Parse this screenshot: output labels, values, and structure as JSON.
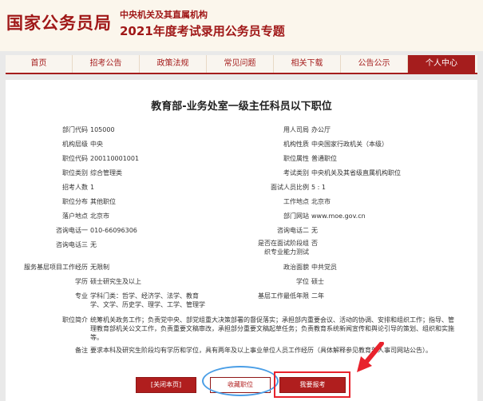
{
  "header": {
    "logo": "国家公务员局",
    "sub1": "中央机关及其直属机构",
    "sub2": "2021年度考试录用公务员专题"
  },
  "nav": {
    "items": [
      "首页",
      "招考公告",
      "政策法规",
      "常见问题",
      "相关下载",
      "公告公示",
      "个人中心"
    ],
    "active_index": 6
  },
  "position": {
    "title": "教育部-业务处室一级主任科员以下职位",
    "left": [
      {
        "label": "部门代码",
        "value": "105000"
      },
      {
        "label": "机构层级",
        "value": "中央"
      },
      {
        "label": "职位代码",
        "value": "200110001001"
      },
      {
        "label": "职位类别",
        "value": "综合管理类"
      },
      {
        "label": "招考人数",
        "value": "1"
      },
      {
        "label": "职位分布",
        "value": "其他职位"
      },
      {
        "label": "落户地点",
        "value": "北京市"
      },
      {
        "label": "咨询电话一",
        "value": "010-66096306"
      },
      {
        "label": "咨询电话三",
        "value": "无"
      }
    ],
    "right": [
      {
        "label": "用人司局",
        "value": "办公厅"
      },
      {
        "label": "机构性质",
        "value": "中央国家行政机关（本级）"
      },
      {
        "label": "职位属性",
        "value": "普通职位"
      },
      {
        "label": "考试类别",
        "value": "中央机关及其省级直属机构职位"
      },
      {
        "label": "面试人员比例",
        "value": "5 : 1"
      },
      {
        "label": "工作地点",
        "value": "北京市"
      },
      {
        "label": "部门网站",
        "value": "www.moe.gov.cn"
      },
      {
        "label": "咨询电话二",
        "value": "无"
      },
      {
        "label": "是否在面试阶段组织专业能力测试",
        "value": "否"
      }
    ],
    "service_label": "服务基层项目工作经历",
    "service_value": "无限制",
    "political_label": "政治面貌",
    "political_value": "中共党员",
    "education_label": "学历",
    "education_value": "硕士研究生及以上",
    "degree_label": "学位",
    "degree_value": "硕士",
    "major_label": "专业",
    "major_value": "学科门类：哲学、经济学、法学、教育学、文学、历史学、理学、工学、管理学",
    "years_label": "基层工作最低年限",
    "years_value": "二年",
    "duty_label": "职位简介",
    "duty_value": "统筹机关政务工作；负责党中央、部党组重大决策部署的督促落实；承担部内重要会议、活动的协调、安排和组织工作；指导、管理教育部机关公文工作，负责重要文稿审改，承担部分重要文稿起草任务；负责教育系统新闻宣传和舆论引导的策划、组织和实施等。",
    "remark_label": "备注",
    "remark_value": "要求本科及研究生阶段均有学历和学位，具有两年及以上事业单位人员工作经历（具体解释参见教育部人事司网站公告）。"
  },
  "buttons": {
    "close": "[关闭本页]",
    "favorite": "收藏职位",
    "apply": "我要报考"
  },
  "annotation_colors": {
    "ring": "#4a9ee6",
    "highlight": "#e8222c"
  }
}
